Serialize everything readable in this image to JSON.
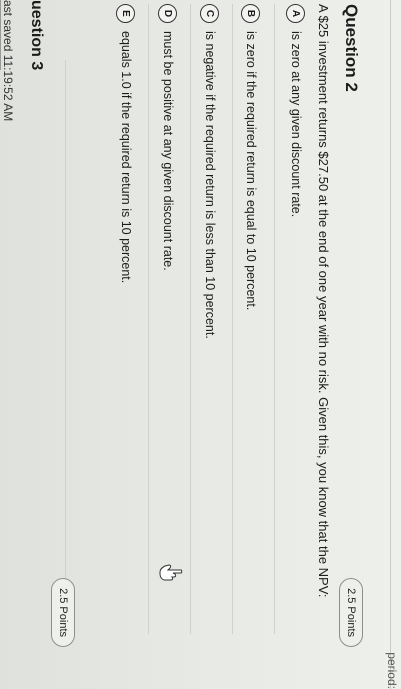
{
  "header": {
    "right_text": "period:"
  },
  "question2": {
    "title": "Question 2",
    "points": "2.5 Points",
    "stem": "A $25 investment returns $27.50 at the end of one year with no risk. Given this, you know that the NPV:",
    "choices": [
      {
        "letter": "A",
        "text": "is zero at any given discount rate."
      },
      {
        "letter": "B",
        "text": "is zero if the required return is equal to 10 percent."
      },
      {
        "letter": "C",
        "text": "is negative if the required return is less than 10 percent."
      },
      {
        "letter": "D",
        "text": "must be positive at any given discount rate."
      },
      {
        "letter": "E",
        "text": "equals 1.0 if the required return is 10 percent."
      }
    ]
  },
  "question3": {
    "title": "uestion 3",
    "points": "2.5 Points"
  },
  "footer": {
    "last_saved": "ast saved 11:19:52 AM"
  },
  "icons": {
    "cursor": "hand-pointer-icon"
  }
}
